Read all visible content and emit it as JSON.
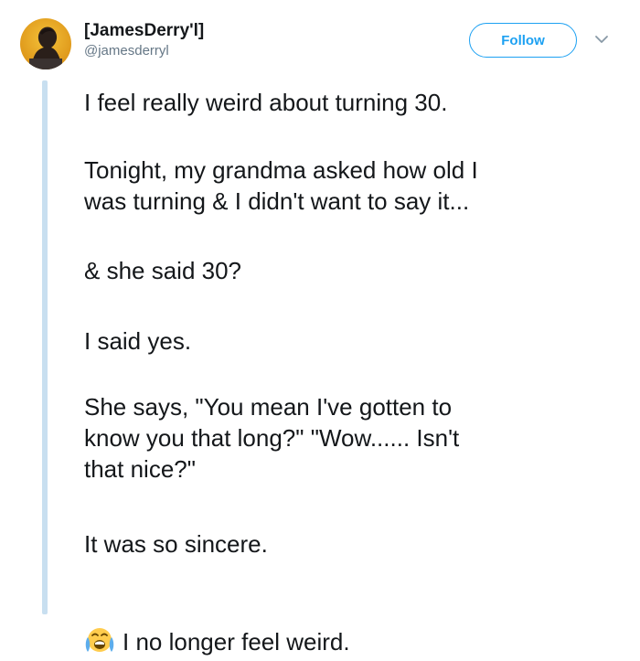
{
  "author": {
    "display_name": "[JamesDerry'l]",
    "handle": "@jamesderryl",
    "avatar_icon": "user-avatar"
  },
  "actions": {
    "follow_label": "Follow",
    "menu_icon": "chevron-down-icon"
  },
  "tweet": {
    "paragraphs": [
      "I feel really weird about turning 30.",
      "Tonight, my grandma asked how old I\nwas turning & I didn't want to say it...",
      "& she said 30?",
      "I said yes.",
      "She says, \"You mean I've gotten to\nknow you that long?\" \"Wow...... Isn't\nthat nice?\"",
      "It was so sincere."
    ],
    "last_line": "I no longer feel weird.",
    "last_line_emoji": "loudly-crying-face-icon"
  },
  "colors": {
    "accent": "#1da1f2",
    "thread_line": "#c8dff0",
    "text": "#14171a",
    "secondary_text": "#657786"
  }
}
